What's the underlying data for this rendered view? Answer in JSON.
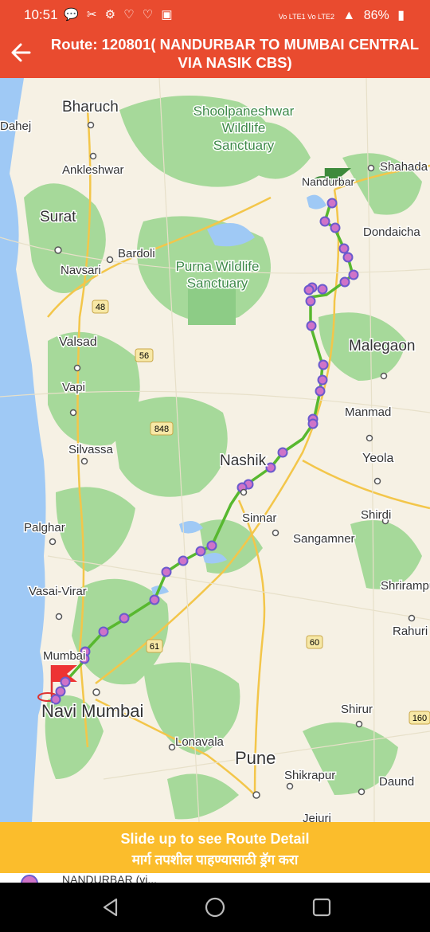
{
  "status": {
    "time": "10:51",
    "notif_icons": "💬 ✂ ⚙ ♡ ♡ ▣",
    "network": "Vo LTE1  Vo LTE2",
    "battery": "86%"
  },
  "appbar": {
    "title": "Route: 120801( NANDURBAR TO MUMBAI CENTRAL VIA NASIK CBS)"
  },
  "map": {
    "colors": {
      "route": "#58b82f",
      "stop_fill": "#cf73c8",
      "stop_stroke": "#6a5acd",
      "water": "#9fc9f5",
      "land": "#f6f1e4",
      "forest": "#a6d99a"
    },
    "labels": {
      "bharuch": "Bharuch",
      "dahej": "Dahej",
      "shoolpaneshwar": "Shoolpaneshwar",
      "wildlife": "Wildlife",
      "sanctuary1": "Sanctuary",
      "ankleshwar": "Ankleshwar",
      "nandurbar": "Nandurbar",
      "shahada": "Shahada",
      "surat": "Surat",
      "dondaicha": "Dondaicha",
      "bardoli": "Bardoli",
      "purna": "Purna Wildlife",
      "sanctuary2": "Sanctuary",
      "navsari": "Navsari",
      "valsad": "Valsad",
      "malegaon": "Malegaon",
      "vapi": "Vapi",
      "manmad": "Manmad",
      "silvassa": "Silvassa",
      "nashik": "Nashik",
      "yeola": "Yeola",
      "palghar": "Palghar",
      "sinnar": "Sinnar",
      "shirdi": "Shirdi",
      "sangamner": "Sangamner",
      "vasai": "Vasai-Virar",
      "shrirampur": "Shrirampur",
      "rahuri": "Rahuri",
      "mumbai": "Mumbai",
      "navimumbai": "Navi Mumbai",
      "shirur": "Shirur",
      "lonavala": "Lonavala",
      "pune": "Pune",
      "shikrapur": "Shikrapur",
      "daund": "Daund",
      "jejuri": "Jejuri"
    },
    "shields": {
      "h48": "48",
      "h56": "56",
      "h848": "848",
      "h61": "61",
      "h60": "60",
      "h160": "160"
    }
  },
  "banner": {
    "line1": "Slide up to see Route Detail",
    "line2": "मार्ग तपशील पाहण्यासाठी ड्रॅग करा"
  },
  "sheet": {
    "first_stop": "NANDURBAR (vi..."
  }
}
